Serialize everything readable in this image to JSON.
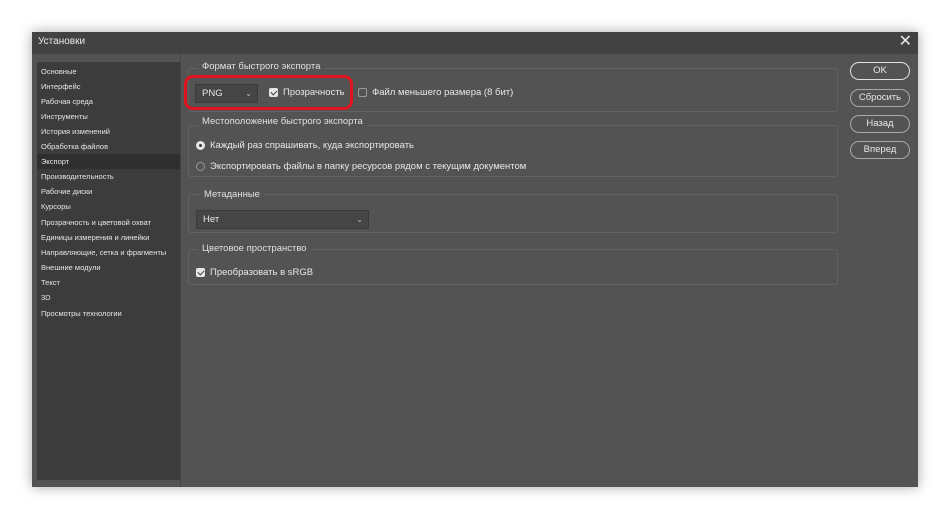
{
  "window": {
    "title": "Установки"
  },
  "sidebar": {
    "items": [
      {
        "label": "Основные"
      },
      {
        "label": "Интерфейс"
      },
      {
        "label": "Рабочая среда"
      },
      {
        "label": "Инструменты"
      },
      {
        "label": "История изменений"
      },
      {
        "label": "Обработка файлов"
      },
      {
        "label": "Экспорт"
      },
      {
        "label": "Производительность"
      },
      {
        "label": "Рабочие диски"
      },
      {
        "label": "Курсоры"
      },
      {
        "label": "Прозрачность и цветовой охват"
      },
      {
        "label": "Единицы измерения и линейки"
      },
      {
        "label": "Направляющие, сетка и фрагменты"
      },
      {
        "label": "Внешние модули"
      },
      {
        "label": "Текст"
      },
      {
        "label": "3D"
      },
      {
        "label": "Просмотры технологии"
      }
    ],
    "selected": "Экспорт"
  },
  "quick_export": {
    "legend": "Формат быстрого экспорта",
    "format_value": "PNG",
    "transparency_label": "Прозрачность",
    "transparency_checked": true,
    "smaller_file_label": "Файл меньшего размера (8 бит)",
    "smaller_file_checked": false
  },
  "export_location": {
    "legend": "Местоположение быстрого экспорта",
    "option1": "Каждый раз спрашивать, куда экспортировать",
    "option2": "Экспортировать файлы в папку ресурсов рядом с текущим документом",
    "selected": 1
  },
  "metadata": {
    "legend": "Метаданные",
    "value": "Нет"
  },
  "color_space": {
    "legend": "Цветовое пространство",
    "convert_label": "Преобразовать в sRGB",
    "convert_checked": true
  },
  "buttons": {
    "ok": "OK",
    "reset": "Сбросить",
    "back": "Назад",
    "forward": "Вперед"
  },
  "annotation": {
    "highlight_color": "#e0141e"
  },
  "icons": {
    "close": "close-icon",
    "dropdown": "chevron-down-icon"
  }
}
